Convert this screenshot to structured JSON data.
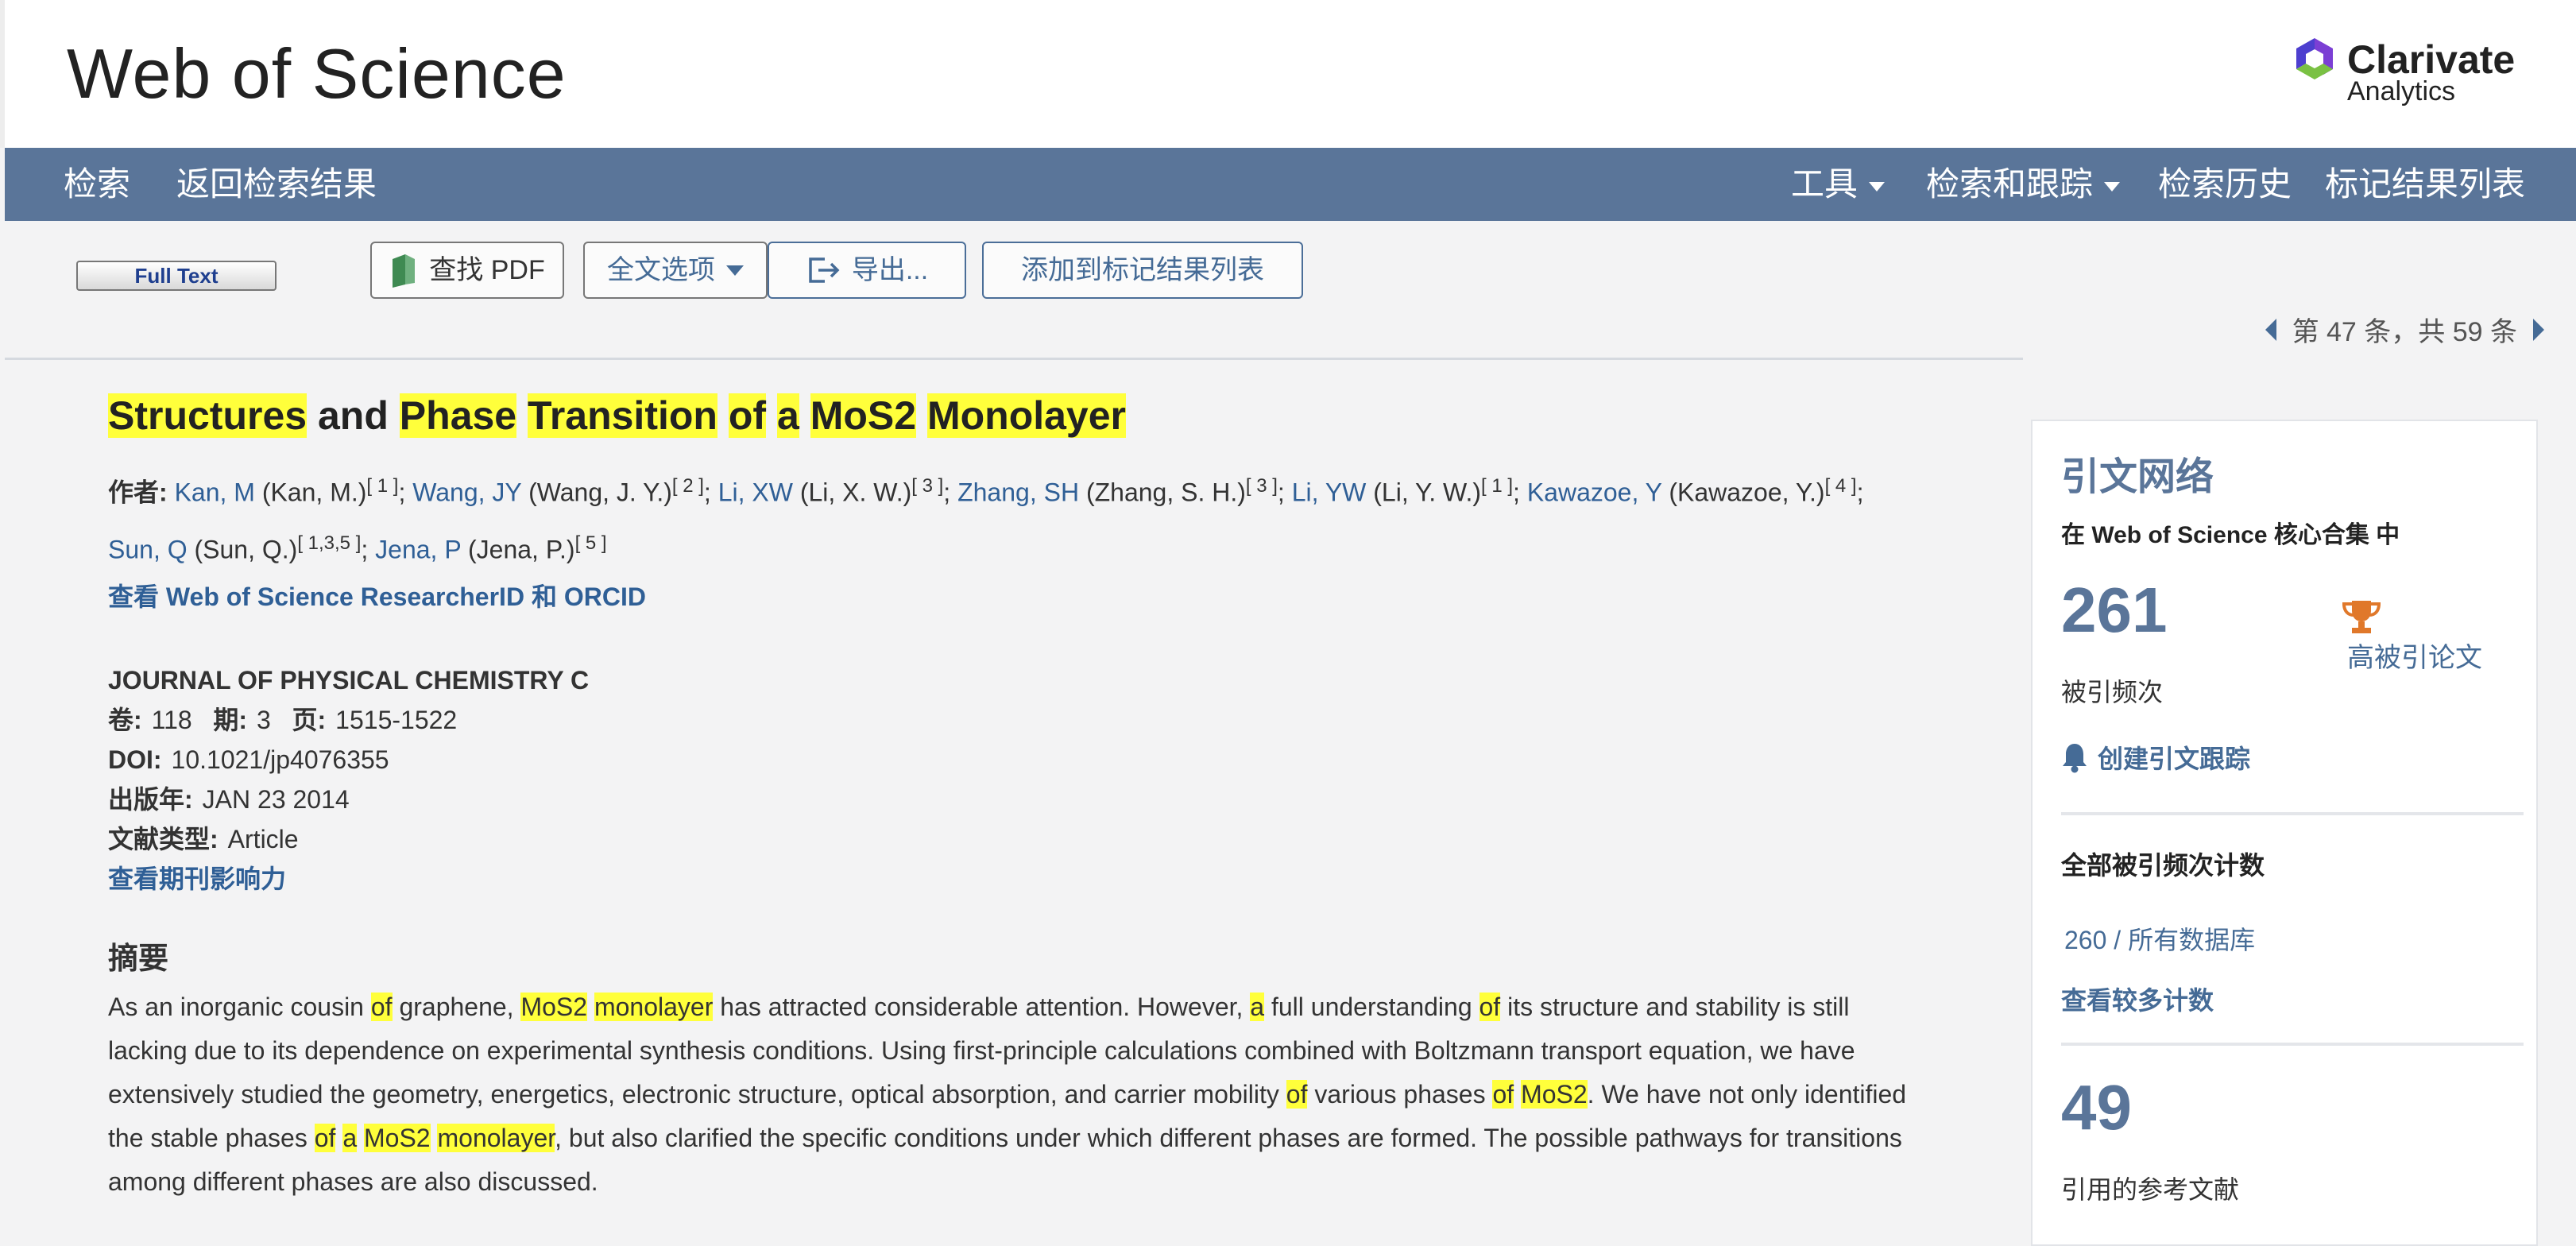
{
  "header": {
    "brand": "Web of Science",
    "partner_line1": "Clarivate",
    "partner_line2": "Analytics"
  },
  "nav": {
    "search": "检索",
    "back_to_results": "返回检索结果",
    "tools": "工具",
    "search_and_track": "检索和跟踪",
    "search_history": "检索历史",
    "marked_list": "标记结果列表"
  },
  "toolbar": {
    "full_text": "Full Text",
    "find_pdf": "查找 PDF",
    "full_text_options": "全文选项",
    "export": "导出...",
    "add_to_marked": "添加到标记结果列表",
    "pager": "第 47 条，共 59 条"
  },
  "record": {
    "title_parts": [
      "Structures",
      "and",
      "Phase",
      "Transition",
      "of",
      "a",
      "MoS2",
      "Monolayer"
    ],
    "authors_label": "作者:",
    "authors": [
      {
        "link": "Kan, M",
        "full": "(Kan, M.)",
        "aff": "[ 1 ]"
      },
      {
        "link": "Wang, JY",
        "full": "(Wang, J. Y.)",
        "aff": "[ 2 ]"
      },
      {
        "link": "Li, XW",
        "full": "(Li, X. W.)",
        "aff": "[ 3 ]"
      },
      {
        "link": "Zhang, SH",
        "full": "(Zhang, S. H.)",
        "aff": "[ 3 ]"
      },
      {
        "link": "Li, YW",
        "full": "(Li, Y. W.)",
        "aff": "[ 1 ]"
      },
      {
        "link": "Kawazoe, Y",
        "full": "(Kawazoe, Y.)",
        "aff": "[ 4 ]"
      },
      {
        "link": "Sun, Q",
        "full": "(Sun, Q.)",
        "aff": "[ 1,3,5 ]"
      },
      {
        "link": "Jena, P",
        "full": "(Jena, P.)",
        "aff": "[ 5 ]"
      }
    ],
    "researcher_link": "查看 Web of Science ResearcherID 和 ORCID",
    "journal": "JOURNAL OF PHYSICAL CHEMISTRY C",
    "volume_label": "卷:",
    "volume": "118",
    "issue_label": "期:",
    "issue": "3",
    "pages_label": "页:",
    "pages": "1515-1522",
    "doi_label": "DOI:",
    "doi": "10.1021/jp4076355",
    "pubyear_label": "出版年:",
    "pubyear": "JAN 23 2014",
    "doctype_label": "文献类型:",
    "doctype": "Article",
    "impact_link": "查看期刊影响力",
    "abstract_heading": "摘要",
    "abstract": [
      {
        "t": "As an inorganic cousin ",
        "h": false
      },
      {
        "t": "of",
        "h": true
      },
      {
        "t": " graphene, ",
        "h": false
      },
      {
        "t": "MoS2",
        "h": true
      },
      {
        "t": " ",
        "h": false
      },
      {
        "t": "monolayer",
        "h": true
      },
      {
        "t": " has attracted considerable attention. However, ",
        "h": false
      },
      {
        "t": "a",
        "h": true
      },
      {
        "t": " full understanding ",
        "h": false
      },
      {
        "t": "of",
        "h": true
      },
      {
        "t": " its structure and stability is still lacking due to its dependence on experimental synthesis conditions. Using first-principle calculations combined with Boltzmann transport equation, we have extensively studied the geometry, energetics, electronic structure, optical absorption, and carrier mobility ",
        "h": false
      },
      {
        "t": "of",
        "h": true
      },
      {
        "t": " various phases ",
        "h": false
      },
      {
        "t": "of",
        "h": true
      },
      {
        "t": " ",
        "h": false
      },
      {
        "t": "MoS2",
        "h": true
      },
      {
        "t": ". We have not only identified the stable phases ",
        "h": false
      },
      {
        "t": "of",
        "h": true
      },
      {
        "t": " ",
        "h": false
      },
      {
        "t": "a",
        "h": true
      },
      {
        "t": " ",
        "h": false
      },
      {
        "t": "MoS2",
        "h": true
      },
      {
        "t": " ",
        "h": false
      },
      {
        "t": "monolayer",
        "h": true
      },
      {
        "t": ", but also clarified the specific conditions under which different phases are formed. The possible pathways for transitions among different phases are also discussed.",
        "h": false
      }
    ]
  },
  "sidebar": {
    "title": "引文网络",
    "subtitle": "在 Web of Science 核心合集 中",
    "times_cited": "261",
    "times_cited_label": "被引频次",
    "highly_cited": "高被引论文",
    "create_alert": "创建引文跟踪",
    "all_times_cited_heading": "全部被引频次计数",
    "all_databases": "260 / 所有数据库",
    "view_more_counts": "查看较多计数",
    "references": "49",
    "references_label": "引用的参考文献"
  },
  "colors": {
    "nav_bg": "#5a7599",
    "link": "#2f5f96",
    "highlight": "#ffff3b"
  }
}
